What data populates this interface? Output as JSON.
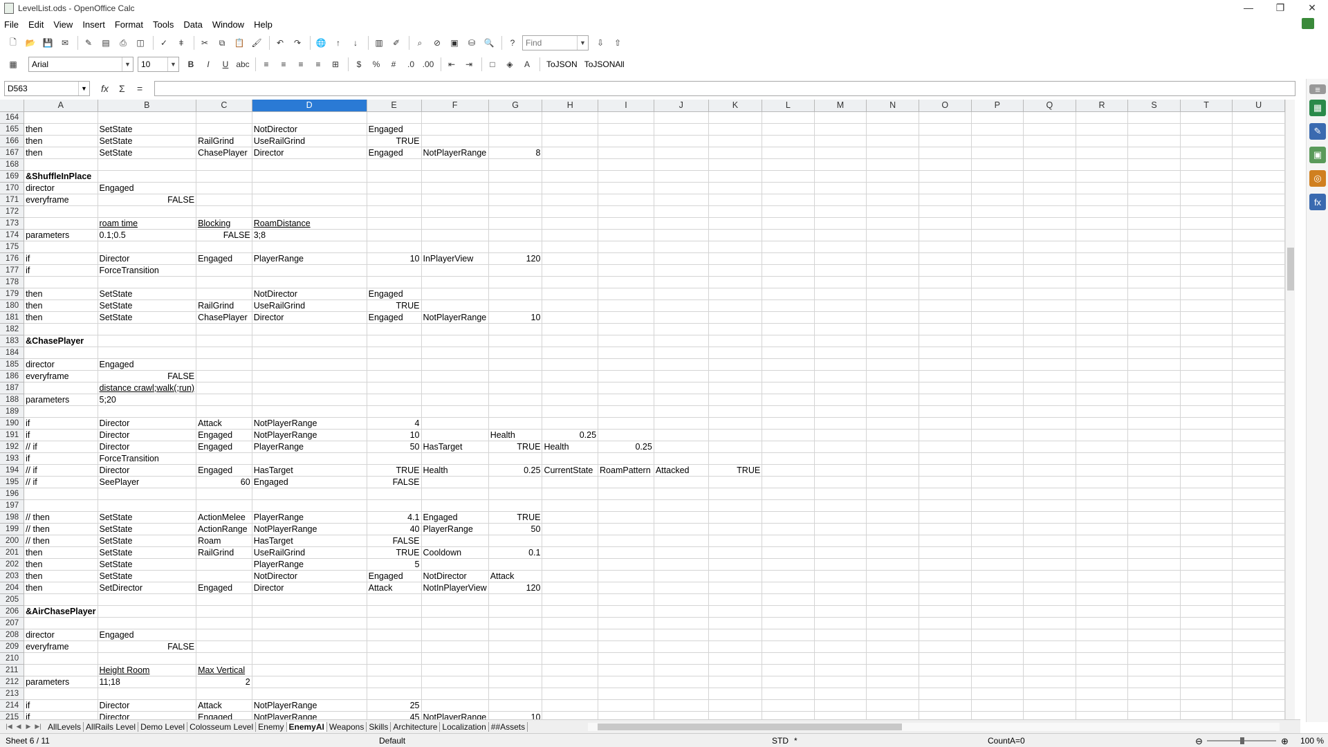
{
  "window": {
    "title": "LevelList.ods - OpenOffice Calc",
    "controls": [
      "—",
      "❐",
      "✕"
    ]
  },
  "menu": [
    "File",
    "Edit",
    "View",
    "Insert",
    "Format",
    "Tools",
    "Data",
    "Window",
    "Help"
  ],
  "toolbar": {
    "find_placeholder": "Find",
    "font_name": "Arial",
    "font_size": "10",
    "tojson": "ToJSON",
    "tojsonall": "ToJSONAll"
  },
  "formula": {
    "cell_ref": "D563",
    "content": ""
  },
  "columns": [
    "A",
    "B",
    "C",
    "D",
    "E",
    "F",
    "G",
    "H",
    "I",
    "J",
    "K",
    "L",
    "M",
    "N",
    "O",
    "P",
    "Q",
    "R",
    "S",
    "T",
    "U"
  ],
  "selected_column": "D",
  "rows": [
    {
      "n": "164",
      "c": {}
    },
    {
      "n": "165",
      "c": {
        "A": "then",
        "B": "SetState",
        "D": "NotDirector",
        "E": "Engaged"
      }
    },
    {
      "n": "166",
      "c": {
        "A": "then",
        "B": "SetState",
        "C": "RailGrind",
        "D": "UseRailGrind",
        "E": "TRUE"
      }
    },
    {
      "n": "167",
      "c": {
        "A": "then",
        "B": "SetState",
        "C": "ChasePlayer",
        "D": "Director",
        "E": "Engaged",
        "F": "NotPlayerRange",
        "G": "8"
      }
    },
    {
      "n": "168",
      "c": {}
    },
    {
      "n": "169",
      "c": {
        "A": "&ShuffleInPlace"
      },
      "bold": true
    },
    {
      "n": "170",
      "c": {
        "A": "director",
        "B": "Engaged"
      }
    },
    {
      "n": "171",
      "c": {
        "A": "everyframe",
        "B": "FALSE"
      }
    },
    {
      "n": "172",
      "c": {}
    },
    {
      "n": "173",
      "c": {
        "B": "roam time",
        "C": "Blocking",
        "D": "RoamDistance"
      },
      "underline": true
    },
    {
      "n": "174",
      "c": {
        "A": "parameters",
        "B": "0.1;0.5",
        "C": "FALSE",
        "D": "3;8"
      }
    },
    {
      "n": "175",
      "c": {}
    },
    {
      "n": "176",
      "c": {
        "A": "if",
        "B": "Director",
        "C": "Engaged",
        "D": "PlayerRange",
        "E": "10",
        "F": "InPlayerView",
        "G": "120"
      }
    },
    {
      "n": "177",
      "c": {
        "A": "if",
        "B": "ForceTransition"
      }
    },
    {
      "n": "178",
      "c": {}
    },
    {
      "n": "179",
      "c": {
        "A": "then",
        "B": "SetState",
        "D": "NotDirector",
        "E": "Engaged"
      }
    },
    {
      "n": "180",
      "c": {
        "A": "then",
        "B": "SetState",
        "C": "RailGrind",
        "D": "UseRailGrind",
        "E": "TRUE"
      }
    },
    {
      "n": "181",
      "c": {
        "A": "then",
        "B": "SetState",
        "C": "ChasePlayer",
        "D": "Director",
        "E": "Engaged",
        "F": "NotPlayerRange",
        "G": "10"
      }
    },
    {
      "n": "182",
      "c": {}
    },
    {
      "n": "183",
      "c": {
        "A": "&ChasePlayer"
      },
      "bold": true
    },
    {
      "n": "184",
      "c": {}
    },
    {
      "n": "185",
      "c": {
        "A": "director",
        "B": "Engaged"
      }
    },
    {
      "n": "186",
      "c": {
        "A": "everyframe",
        "B": "FALSE"
      }
    },
    {
      "n": "187",
      "c": {
        "B": "distance crawl;walk(;run)"
      },
      "underline": true
    },
    {
      "n": "188",
      "c": {
        "A": "parameters",
        "B": "5;20"
      }
    },
    {
      "n": "189",
      "c": {}
    },
    {
      "n": "190",
      "c": {
        "A": "if",
        "B": "Director",
        "C": "Attack",
        "D": "NotPlayerRange",
        "E": "4"
      }
    },
    {
      "n": "191",
      "c": {
        "A": "if",
        "B": "Director",
        "C": "Engaged",
        "D": "NotPlayerRange",
        "E": "10",
        "G": "Health",
        "H": "0.25"
      }
    },
    {
      "n": "192",
      "c": {
        "A": "// if",
        "B": "Director",
        "C": "Engaged",
        "D": "PlayerRange",
        "E": "50",
        "F": "HasTarget",
        "G": "TRUE",
        "H": "Health",
        "I": "0.25"
      }
    },
    {
      "n": "193",
      "c": {
        "A": "if",
        "B": "ForceTransition"
      }
    },
    {
      "n": "194",
      "c": {
        "A": "// if",
        "B": "Director",
        "C": "Engaged",
        "D": "HasTarget",
        "E": "TRUE",
        "F": "Health",
        "G": "0.25",
        "H": "CurrentState",
        "I": "RoamPattern",
        "J": "Attacked",
        "K": "TRUE"
      }
    },
    {
      "n": "195",
      "c": {
        "A": "// if",
        "B": "SeePlayer",
        "C": "60",
        "D": "Engaged",
        "E": "FALSE"
      }
    },
    {
      "n": "196",
      "c": {}
    },
    {
      "n": "197",
      "c": {}
    },
    {
      "n": "198",
      "c": {
        "A": "// then",
        "B": "SetState",
        "C": "ActionMelee",
        "D": "PlayerRange",
        "E": "4.1",
        "F": "Engaged",
        "G": "TRUE"
      }
    },
    {
      "n": "199",
      "c": {
        "A": "// then",
        "B": "SetState",
        "C": "ActionRange",
        "D": "NotPlayerRange",
        "E": "40",
        "F": "PlayerRange",
        "G": "50"
      }
    },
    {
      "n": "200",
      "c": {
        "A": "// then",
        "B": "SetState",
        "C": "Roam",
        "D": "HasTarget",
        "E": "FALSE"
      }
    },
    {
      "n": "201",
      "c": {
        "A": "then",
        "B": "SetState",
        "C": "RailGrind",
        "D": "UseRailGrind",
        "E": "TRUE",
        "F": "Cooldown",
        "G": "0.1"
      }
    },
    {
      "n": "202",
      "c": {
        "A": "then",
        "B": "SetState",
        "D": "PlayerRange",
        "E": "5"
      }
    },
    {
      "n": "203",
      "c": {
        "A": "then",
        "B": "SetState",
        "D": "NotDirector",
        "E": "Engaged",
        "F": "NotDirector",
        "G": "Attack"
      }
    },
    {
      "n": "204",
      "c": {
        "A": "then",
        "B": "SetDirector",
        "C": "Engaged",
        "D": "Director",
        "E": "Attack",
        "F": "NotInPlayerView",
        "G": "120"
      }
    },
    {
      "n": "205",
      "c": {}
    },
    {
      "n": "206",
      "c": {
        "A": "&AirChasePlayer"
      },
      "bold": true
    },
    {
      "n": "207",
      "c": {}
    },
    {
      "n": "208",
      "c": {
        "A": "director",
        "B": "Engaged"
      }
    },
    {
      "n": "209",
      "c": {
        "A": "everyframe",
        "B": "FALSE"
      }
    },
    {
      "n": "210",
      "c": {}
    },
    {
      "n": "211",
      "c": {
        "B": "Height Room",
        "C": "Max Vertical"
      },
      "underline": true
    },
    {
      "n": "212",
      "c": {
        "A": "parameters",
        "B": "11;18",
        "C": "2"
      }
    },
    {
      "n": "213",
      "c": {}
    },
    {
      "n": "214",
      "c": {
        "A": "if",
        "B": "Director",
        "C": "Attack",
        "D": "NotPlayerRange",
        "E": "25"
      }
    },
    {
      "n": "215",
      "c": {
        "A": "if",
        "B": "Director",
        "C": "Engaged",
        "D": "NotPlayerRange",
        "E": "45",
        "F": "NotPlayerRange",
        "G": "10"
      }
    }
  ],
  "sheet_tabs": [
    "AllLevels",
    "AllRails Level",
    "Demo Level",
    "Colosseum Level",
    "Enemy",
    "EnemyAI",
    "Weapons",
    "Skills",
    "Architecture",
    "Localization",
    "##Assets"
  ],
  "active_tab": "EnemyAI",
  "status": {
    "sheet": "Sheet 6 / 11",
    "style": "Default",
    "mode": "STD",
    "modified": "*",
    "sum": "CountA=0",
    "zoom": "100 %"
  }
}
